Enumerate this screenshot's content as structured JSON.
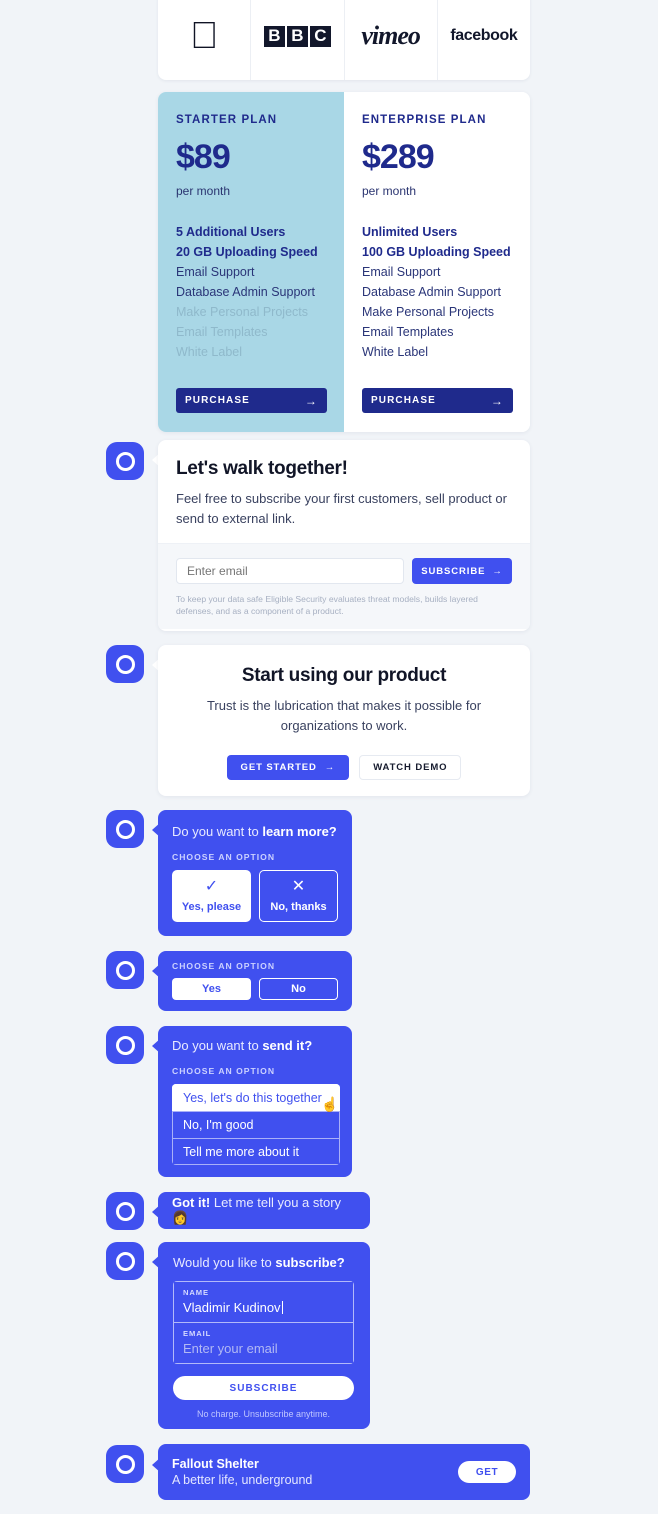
{
  "logos": [
    {
      "name": "apple-logo",
      "type": "glyph",
      "text": ""
    },
    {
      "name": "bbc-logo",
      "type": "bbc",
      "letters": [
        "B",
        "B",
        "C"
      ]
    },
    {
      "name": "vimeo-logo",
      "type": "word",
      "text": "vimeo"
    },
    {
      "name": "facebook-logo",
      "type": "word",
      "text": "facebook"
    }
  ],
  "pricing": {
    "starter": {
      "name": "STARTER PLAN",
      "price": "$89",
      "period": "per month",
      "features": [
        {
          "label": "5 Additional Users",
          "style": "strong"
        },
        {
          "label": "20 GB Uploading Speed",
          "style": "strong"
        },
        {
          "label": "Email Support",
          "style": "normal"
        },
        {
          "label": "Database Admin Support",
          "style": "normal"
        },
        {
          "label": "Make Personal Projects",
          "style": "muted"
        },
        {
          "label": "Email Templates",
          "style": "muted"
        },
        {
          "label": "White Label",
          "style": "muted"
        }
      ],
      "button": "PURCHASE",
      "button_arrow": "→"
    },
    "enterprise": {
      "name": "ENTERPRISE PLAN",
      "price": "$289",
      "period": "per month",
      "features": [
        {
          "label": "Unlimited Users",
          "style": "strong"
        },
        {
          "label": "100 GB Uploading Speed",
          "style": "strong"
        },
        {
          "label": "Email Support",
          "style": "normal"
        },
        {
          "label": "Database Admin Support",
          "style": "normal"
        },
        {
          "label": "Make Personal Projects",
          "style": "normal"
        },
        {
          "label": "Email Templates",
          "style": "normal"
        },
        {
          "label": "White Label",
          "style": "normal"
        }
      ],
      "button": "PURCHASE",
      "button_arrow": "→"
    }
  },
  "walk_card": {
    "title": "Let's walk together!",
    "subtitle": "Feel free to subscribe your first customers, sell product or send to external link.",
    "email_placeholder": "Enter email",
    "email_value": "",
    "subscribe_label": "SUBSCRIBE",
    "subscribe_arrow": "→",
    "fineprint": "To keep your data safe Eligible Security evaluates threat models, builds layered defenses, and as a component of a product."
  },
  "start_card": {
    "title": "Start using our product",
    "subtitle": "Trust is the lubrication that makes it possible for organizations to work.",
    "primary_label": "GET STARTED",
    "primary_arrow": "→",
    "secondary_label": "WATCH DEMO"
  },
  "learn_more_bubble": {
    "question_plain": "Do you want to ",
    "question_bold": "learn more?",
    "choose_label": "CHOOSE AN OPTION",
    "options": [
      {
        "glyph": "✓",
        "label": "Yes, please",
        "selected": true
      },
      {
        "glyph": "✕",
        "label": "No, thanks",
        "selected": false
      }
    ]
  },
  "yes_no_bubble": {
    "choose_label": "CHOOSE AN OPTION",
    "options": [
      {
        "label": "Yes",
        "selected": true
      },
      {
        "label": "No",
        "selected": false
      }
    ]
  },
  "send_it_bubble": {
    "question_plain": "Do you want to ",
    "question_bold": "send it?",
    "choose_label": "CHOOSE AN OPTION",
    "options": [
      {
        "label": "Yes, let's do this together",
        "highlighted": true
      },
      {
        "label": "No, I'm good",
        "highlighted": false
      },
      {
        "label": "Tell me more about it",
        "highlighted": false
      }
    ]
  },
  "story_bubble": {
    "bold": "Got it!",
    "plain": " Let me tell you a story ",
    "emoji": "👩"
  },
  "subscribe_bubble": {
    "question_plain": "Would you like to ",
    "question_bold": "subscribe?",
    "name_label": "NAME",
    "name_value": "Vladimir Kudinov",
    "email_label": "EMAIL",
    "email_placeholder": "Enter your email",
    "button_label": "SUBSCRIBE",
    "footnote": "No charge. Unsubscribe anytime."
  },
  "promo": {
    "title": "Fallout Shelter",
    "subtitle": "A better life, underground",
    "button_label": "GET"
  },
  "colors": {
    "background": "#f1f4f8",
    "brand_blue": "#4050ef",
    "navy": "#1f2a8c",
    "starter_bg": "#a9d7e6"
  }
}
